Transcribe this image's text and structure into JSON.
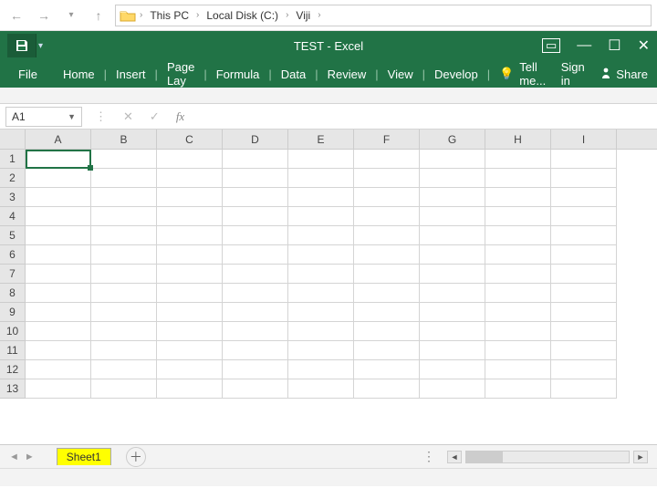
{
  "explorer": {
    "crumbs": [
      "This PC",
      "Local Disk (C:)",
      "Viji"
    ]
  },
  "window": {
    "title": "TEST - Excel"
  },
  "ribbon": {
    "file": "File",
    "tabs": [
      "Home",
      "Insert",
      "Page Lay",
      "Formula",
      "Data",
      "Review",
      "View",
      "Develop"
    ],
    "tellme": "Tell me...",
    "signin": "Sign in",
    "share": "Share"
  },
  "formula_bar": {
    "name_box": "A1",
    "fx": "fx"
  },
  "grid": {
    "columns": [
      "A",
      "B",
      "C",
      "D",
      "E",
      "F",
      "G",
      "H",
      "I"
    ],
    "rows": [
      "1",
      "2",
      "3",
      "4",
      "5",
      "6",
      "7",
      "8",
      "9",
      "10",
      "11",
      "12",
      "13"
    ],
    "selected": "A1"
  },
  "sheets": {
    "active": "Sheet1"
  }
}
